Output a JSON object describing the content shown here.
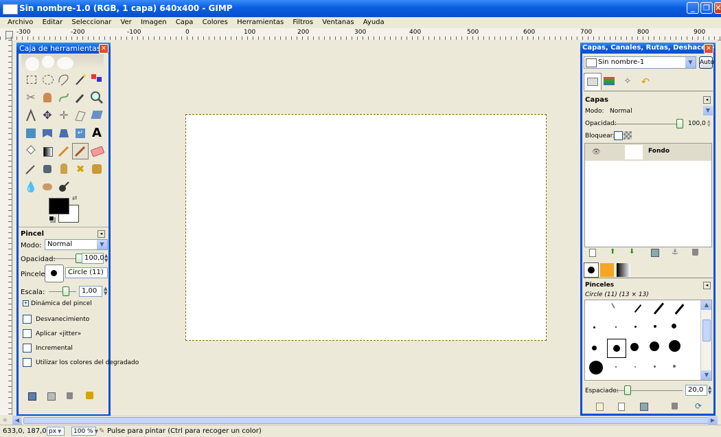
{
  "window": {
    "title": "Sin nombre-1.0 (RGB, 1 capa) 640x400 - GIMP"
  },
  "menu": [
    "Archivo",
    "Editar",
    "Seleccionar",
    "Ver",
    "Imagen",
    "Capa",
    "Colores",
    "Herramientas",
    "Filtros",
    "Ventanas",
    "Ayuda"
  ],
  "ruler": {
    "h_ticks": [
      "-300",
      "-200",
      "-100",
      "0",
      "100",
      "200",
      "300",
      "400",
      "500",
      "600",
      "700",
      "800",
      "900"
    ]
  },
  "toolbox": {
    "title": "Caja de herramientas",
    "tool_options": {
      "title": "Pincel",
      "mode_label": "Modo:",
      "mode_value": "Normal",
      "opacity_label": "Opacidad:",
      "opacity_value": "100,0",
      "opacity_level": 1.0,
      "brushes_label": "Pinceles:",
      "brush_name": "Circle (11)",
      "scale_label": "Escala:",
      "scale_value": "1,00",
      "dynamics": "Dinámica del pincel",
      "fade": "Desvanecimiento",
      "jitter": "Aplicar «jitter»",
      "incremental": "Incremental",
      "gradient": "Utilizar los colores del degradado"
    },
    "colors": {
      "fg": "#000000",
      "bg": "#ffffff"
    }
  },
  "dock": {
    "title": "Capas, Canales, Rutas, Deshacer - Pi...",
    "image_combo": "Sin nombre-1",
    "auto_label": "Auto",
    "layers": {
      "title": "Capas",
      "mode_label": "Modo:",
      "mode_value": "Normal",
      "opacity_label": "Opacidad:",
      "opacity_value": "100,0",
      "opacity_level": 1.0,
      "lock_label": "Bloquear:",
      "layer_name": "Fondo"
    },
    "brushes": {
      "title": "Pinceles",
      "current": "Circle (11) (13 × 13)",
      "spacing_label": "Espaciado:",
      "spacing_value": "20,0",
      "spacing_level": 0.2
    }
  },
  "status": {
    "coords": "633,0, 187,0",
    "unit": "px",
    "zoom": "100 %",
    "message": "Pulse para pintar (Ctrl para recoger un color)"
  }
}
